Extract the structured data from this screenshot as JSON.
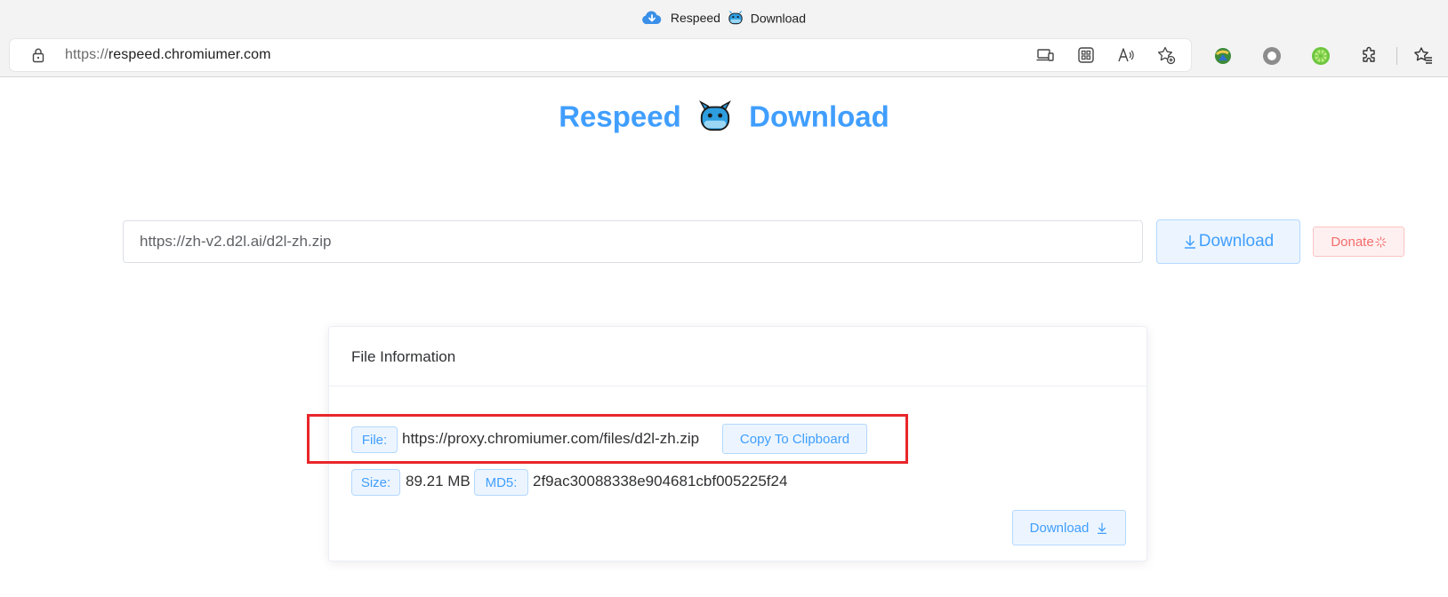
{
  "browser": {
    "tab_title_left": "Respeed",
    "tab_title_right": "Download",
    "url_protocol": "https://",
    "url_host": "respeed.chromiumer.com"
  },
  "page": {
    "title_left": "Respeed",
    "title_right": "Download"
  },
  "form": {
    "url_value": "https://zh-v2.d2l.ai/d2l-zh.zip",
    "download_button": "Download",
    "donate_button": "Donate"
  },
  "file_info": {
    "header": "File Information",
    "file_tag": "File:",
    "file_url": "https://proxy.chromiumer.com/files/d2l-zh.zip",
    "copy_button": "Copy To Clipboard",
    "size_tag": "Size:",
    "size_value": "89.21 MB",
    "md5_tag": "MD5:",
    "md5_value": "2f9ac30088338e904681cbf005225f24",
    "download_button": "Download"
  },
  "colors": {
    "primary": "#409eff",
    "danger": "#f56c6c",
    "highlight_box": "#e8262a"
  },
  "icons": [
    "cloud-download-icon",
    "whale-icon",
    "lock-icon",
    "device-icon",
    "apps-icon",
    "read-aloud-icon",
    "favorite-add-icon",
    "idm-extension-icon",
    "circle-extension-icon",
    "lime-extension-icon",
    "extensions-puzzle-icon",
    "favorites-icon",
    "download-arrow-icon",
    "sparkle-icon"
  ]
}
